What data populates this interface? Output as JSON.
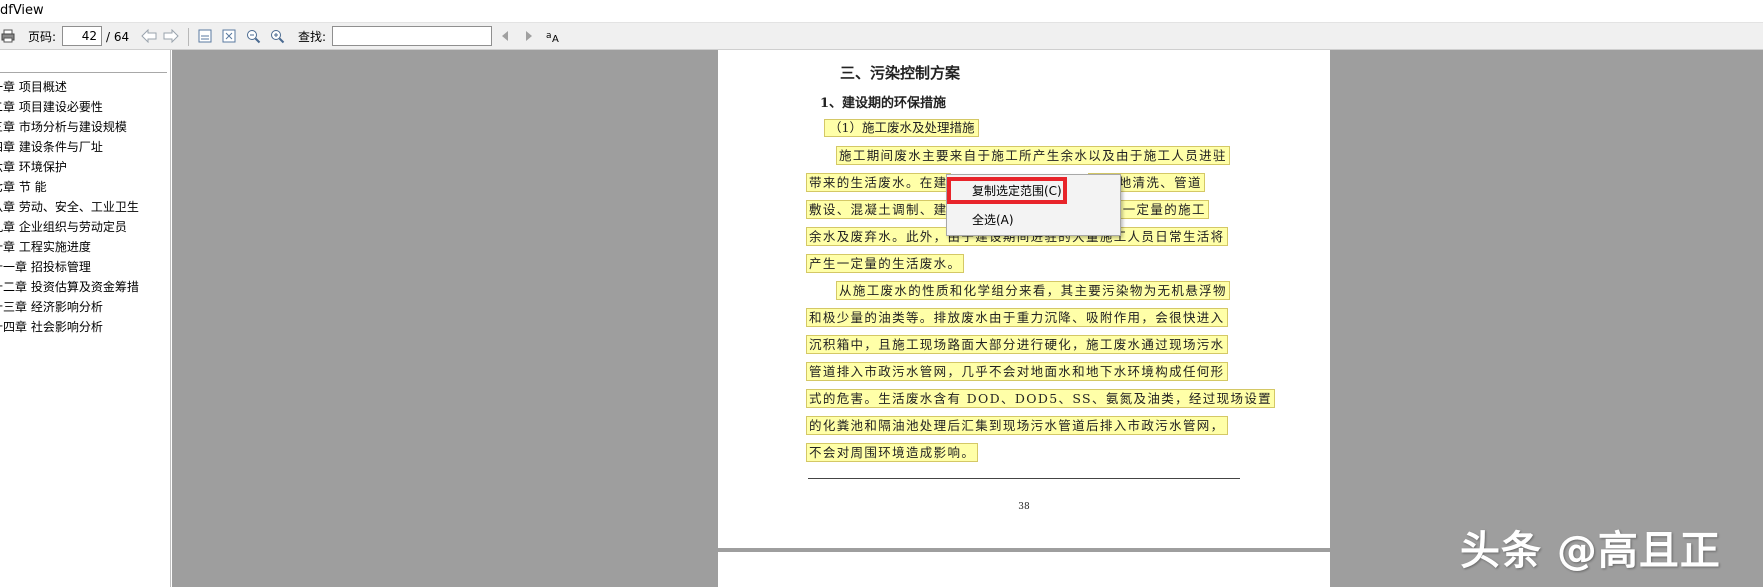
{
  "window": {
    "title": "dfView"
  },
  "toolbar": {
    "page_label": "页码:",
    "page_current": "42",
    "page_total": "/ 64",
    "find_label": "查找:",
    "find_value": "",
    "icons": [
      "print-icon",
      "back-arrow-icon",
      "forward-arrow-icon",
      "fit-width-icon",
      "fit-page-icon",
      "zoom-out-icon",
      "zoom-in-icon",
      "find-prev-icon",
      "find-next-icon",
      "match-case-icon"
    ]
  },
  "sidebar": {
    "items": [
      "一章 项目概述",
      "二章 项目建设必要性",
      "三章 市场分析与建设规模",
      "四章 建设条件与厂址",
      "六章 环境保护",
      "七章 节 能",
      "八章 劳动、安全、工业卫生",
      "九章 企业组织与劳动定员",
      "十章 工程实施进度",
      "十一章 招投标管理",
      "十二章 投资估算及资金筹措",
      "十三章 经济影响分析",
      "十四章 社会影响分析"
    ]
  },
  "document": {
    "heading": "三、污染控制方案",
    "subheading": "1、建设期的环保措施",
    "section_title": "（1）施工废水及处理措施",
    "lines": [
      "施工期间废水主要来自于施工所产生余水以及由于施工人员进驻",
      "带来的生活废水。在建",
      "敷设、混凝土调制、建",
      "余水及废弃水。此外，由于建设期间进驻的大量施工人员日常生活将",
      "产生一定量的生活废水。",
      "从施工废水的性质和化学组分来看，其主要污染物为无机悬浮物",
      "和极少量的油类等。排放废水由于重力沉降、吸附作用，会很快进入",
      "沉积箱中，且施工现场路面大部分进行硬化，施工废水通过现场污水",
      "管道排入市政污水管网，几乎不会对地面水和地下水环境构成任何形",
      "式的危害。生活废水含有 DOD、DOD5、SS、氨氮及油类，经过现场设置",
      "的化粪池和隔油池处理后汇集到现场污水管道后排入市政污水管网，",
      "不会对周围环境造成影响。"
    ],
    "line_tails": {
      "line2_tail": "、场地清洗、管道",
      "line3_tail": "带来一定量的施工"
    },
    "page_number": "38"
  },
  "context_menu": {
    "items": [
      "复制选定范围(C)",
      "全选(A)"
    ]
  },
  "watermark": {
    "text": "头条 @高且正"
  },
  "colors": {
    "highlight": "#ffffa8",
    "annotation_red": "#e8242a",
    "viewer_bg": "#9e9e9e"
  }
}
